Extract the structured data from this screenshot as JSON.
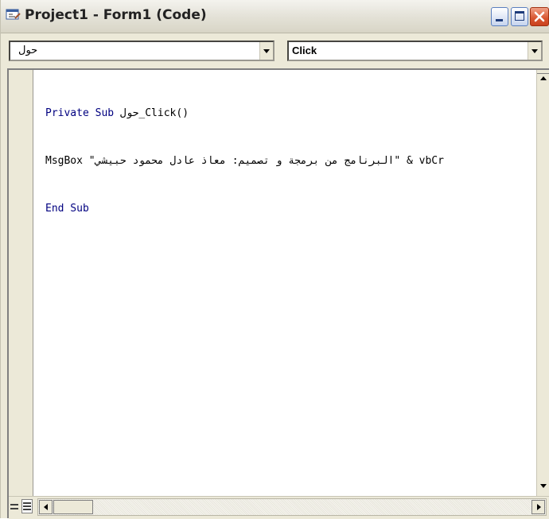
{
  "window": {
    "title": "Project1 - Form1 (Code)",
    "icon": "vb-code-window-icon"
  },
  "title_buttons": {
    "minimize": "minimize-icon",
    "maximize": "maximize-icon",
    "close": "close-icon"
  },
  "object_combo": {
    "value": "حول"
  },
  "procedure_combo": {
    "value": "Click"
  },
  "code": {
    "lines": [
      {
        "keyword": "Private Sub ",
        "rest": "حول_Click()"
      },
      {
        "keyword": "",
        "rest": "MsgBox \"البرنامج من برمجة و تصميم: معاذ عادل محمود حبيشي\" & vbCr"
      },
      {
        "keyword": "End Sub",
        "rest": ""
      }
    ]
  },
  "bottom_bar": {
    "procedure_view": "procedure-view-icon",
    "full_module_view": "full-module-view-icon"
  },
  "colors": {
    "keyword": "#000080",
    "chrome": "#ece9d8",
    "close_button": "#d8552f"
  }
}
